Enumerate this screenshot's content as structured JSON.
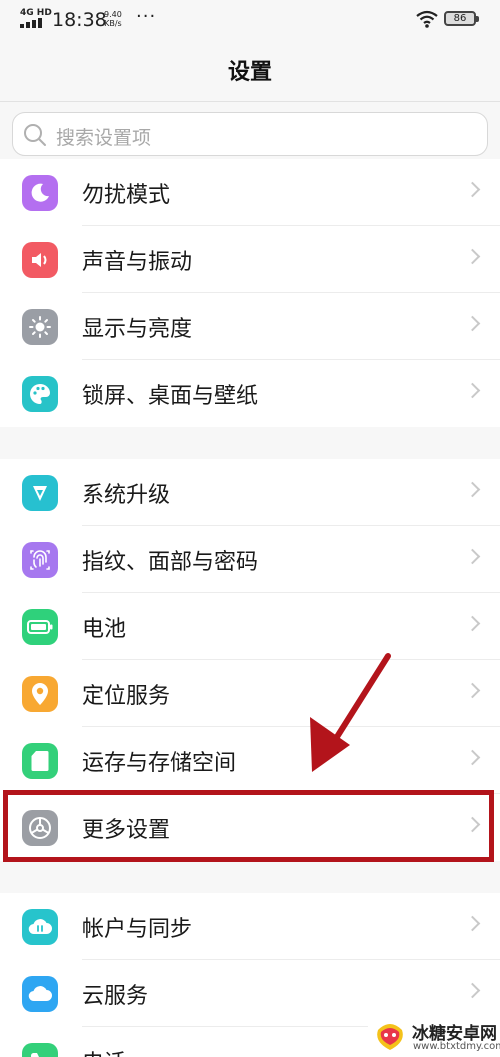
{
  "status_bar": {
    "network": "4G HD",
    "time": "18:38",
    "speed_value": "9.40",
    "speed_unit": "KB/s",
    "dots": "···",
    "battery": "86"
  },
  "header": {
    "title": "设置"
  },
  "search": {
    "placeholder": "搜索设置项"
  },
  "groups": [
    {
      "items": [
        {
          "label": "勿扰模式",
          "icon": "moon-icon",
          "color": "#b46ff0"
        },
        {
          "label": "声音与振动",
          "icon": "speaker-icon",
          "color": "#f25a63"
        },
        {
          "label": "显示与亮度",
          "icon": "sun-icon",
          "color": "#9a9ea5"
        },
        {
          "label": "锁屏、桌面与壁纸",
          "icon": "palette-icon",
          "color": "#27c3c8"
        }
      ]
    },
    {
      "items": [
        {
          "label": "系统升级",
          "icon": "upgrade-icon",
          "color": "#27c0d0"
        },
        {
          "label": "指纹、面部与密码",
          "icon": "fingerprint-icon",
          "color": "#a678ef"
        },
        {
          "label": "电池",
          "icon": "battery-icon",
          "color": "#2fd17b"
        },
        {
          "label": "定位服务",
          "icon": "location-pin-icon",
          "color": "#f8a832"
        },
        {
          "label": "运存与存储空间",
          "icon": "sd-card-icon",
          "color": "#33d07a"
        },
        {
          "label": "更多设置",
          "icon": "gear-icon",
          "color": "#9b9ea4"
        }
      ]
    },
    {
      "items": [
        {
          "label": "帐户与同步",
          "icon": "cloud-sync-icon",
          "color": "#27c4cc"
        },
        {
          "label": "云服务",
          "icon": "cloud-icon",
          "color": "#2ea6f2"
        },
        {
          "label": "电话",
          "icon": "phone-icon",
          "color": "#33d07a"
        }
      ]
    }
  ],
  "watermark": {
    "name": "冰糖安卓网",
    "url": "www.btxtdmy.com"
  }
}
